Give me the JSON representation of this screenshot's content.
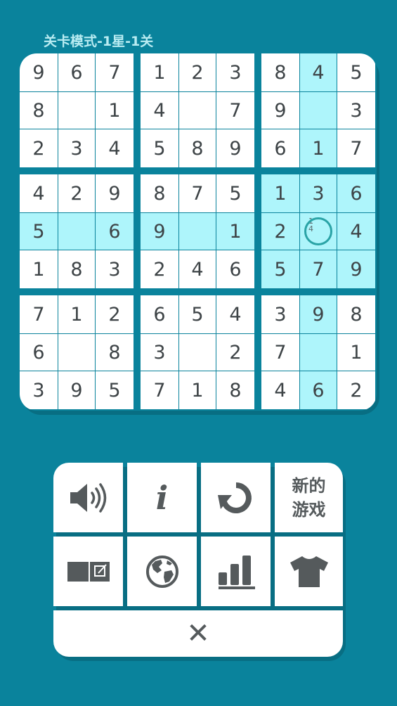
{
  "header": {
    "mode_label": "关卡模式-1星-1关"
  },
  "board": {
    "rows": [
      [
        "9",
        "6",
        "7",
        "1",
        "2",
        "3",
        "8",
        "4",
        "5"
      ],
      [
        "8",
        "",
        "1",
        "4",
        "",
        "7",
        "9",
        "",
        "3"
      ],
      [
        "2",
        "3",
        "4",
        "5",
        "8",
        "9",
        "6",
        "1",
        "7"
      ],
      [
        "4",
        "2",
        "9",
        "8",
        "7",
        "5",
        "1",
        "3",
        "6"
      ],
      [
        "5",
        "",
        "6",
        "9",
        "",
        "1",
        "2",
        "",
        "4"
      ],
      [
        "1",
        "8",
        "3",
        "2",
        "4",
        "6",
        "5",
        "7",
        "9"
      ],
      [
        "7",
        "1",
        "2",
        "6",
        "5",
        "4",
        "3",
        "9",
        "8"
      ],
      [
        "6",
        "",
        "8",
        "3",
        "",
        "2",
        "7",
        "",
        "1"
      ],
      [
        "3",
        "9",
        "5",
        "7",
        "1",
        "8",
        "4",
        "6",
        "2"
      ]
    ],
    "selected": {
      "row": 4,
      "col": 7
    },
    "selected_notes": [
      "1",
      "4"
    ],
    "highlight_color": "#aef5fb",
    "background_color": "#0a839c"
  },
  "menu": {
    "new_game_line1": "新的",
    "new_game_line2": "游戏",
    "icons": {
      "sound": "speaker-icon",
      "info": "info-icon",
      "restart": "restart-icon",
      "notes": "notes-toggle-icon",
      "globe": "globe-icon",
      "stats": "stats-icon",
      "theme": "tshirt-icon",
      "close": "close-icon"
    },
    "info_glyph": "i",
    "close_glyph": "✕"
  }
}
